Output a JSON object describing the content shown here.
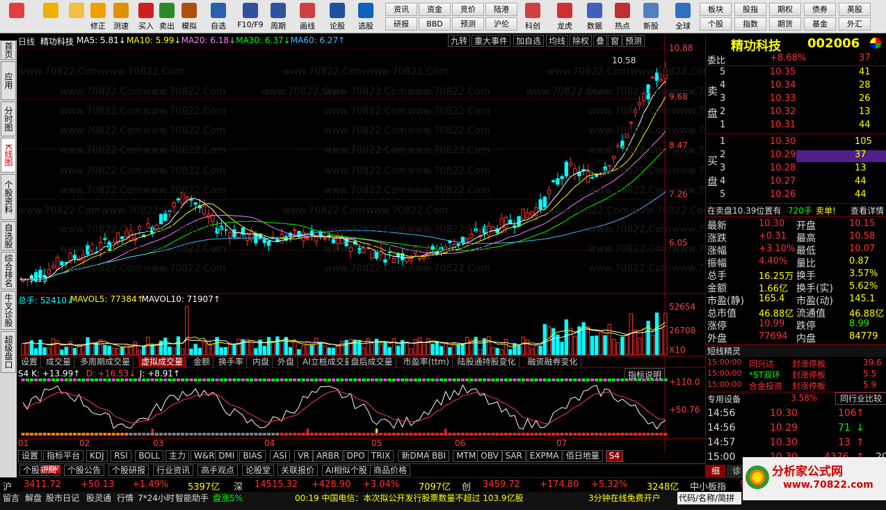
{
  "toolbar": {
    "big": [
      {
        "name": "refresh-icon",
        "label": ""
      },
      {
        "name": "back-icon",
        "label": ""
      },
      {
        "name": "up-icon",
        "label": ""
      },
      {
        "name": "repair-icon",
        "label": "修正"
      },
      {
        "name": "test-speed-icon",
        "label": "测速"
      },
      {
        "name": "buy-icon",
        "label": "买入"
      },
      {
        "name": "sell-icon",
        "label": "卖出"
      },
      {
        "name": "simulate-icon",
        "label": "模拟"
      },
      {
        "name": "self-select-icon",
        "label": "自选"
      },
      {
        "name": "f10-icon",
        "label": "F10/F9"
      },
      {
        "name": "period-icon",
        "label": "周期"
      },
      {
        "name": "draw-line-icon",
        "label": "画线"
      },
      {
        "name": "stock-talk-icon",
        "label": "论股"
      },
      {
        "name": "pick-stock-icon",
        "label": "选股"
      },
      {
        "name": "kechuang-icon",
        "label": "科创"
      },
      {
        "name": "dragon-tiger-icon",
        "label": "龙虎"
      },
      {
        "name": "data-icon",
        "label": "数据"
      },
      {
        "name": "hot-icon",
        "label": "热点"
      },
      {
        "name": "new-stock-icon",
        "label": "新股"
      },
      {
        "name": "global-icon",
        "label": "全球"
      }
    ],
    "small": [
      "资讯",
      "资金",
      "竞价",
      "陆港",
      "研报",
      "BBD",
      "预测",
      "沪伦",
      "板块",
      "股指",
      "期权",
      "债券",
      "英股",
      "个股",
      "指数",
      "期货",
      "基金",
      "外汇"
    ]
  },
  "vtabs": [
    "首页",
    "应用",
    "分时图",
    "K线图",
    "个股资料",
    "自选股",
    "综合排名",
    "牛叉诊股",
    "超级盘口"
  ],
  "chart": {
    "period": "日线",
    "stock_name": "精功科技",
    "ma": [
      {
        "label": "MA5: 5.81↓",
        "color": "#ffffff"
      },
      {
        "label": "MA10: 5.99↓",
        "color": "#ffff00"
      },
      {
        "label": "MA20: 6.18↓",
        "color": "#ff80ff"
      },
      {
        "label": "MA30: 6.37↓",
        "color": "#00ff00"
      },
      {
        "label": "MA60: 6.27↑",
        "color": "#40c0ff"
      }
    ],
    "top_buttons": [
      "九转",
      "重大事件",
      "加自选",
      "均线",
      "除权",
      "叠",
      "窗",
      "预测"
    ],
    "price_axis": [
      "10.88",
      "9.68",
      "8.47",
      "7.26",
      "6.05"
    ],
    "high_label": "10.58",
    "low_label": "5.13",
    "watermarks": [
      "分析家公式网www.70822.Com",
      "www.70822.Com",
      "分析家公式网 www.70822.Com"
    ],
    "volume": {
      "header": [
        {
          "label": "总手: 52410↓",
          "color": "#00ffff"
        },
        {
          "label": "MAVOL5: 77384↑",
          "color": "#ffff00"
        },
        {
          "label": "MAVOL10: 71907↑",
          "color": "#ffffff"
        }
      ],
      "axis": [
        "52654",
        "26708"
      ],
      "unit": "X10"
    },
    "vol_tabs": [
      "设置",
      "成交量",
      "多周期成交量",
      "虚拟成交量",
      "金额",
      "换手率",
      "内盘",
      "外盘",
      "AI立桩成交量",
      "盘后成交量",
      "市盈率(ttm)",
      "陆股通持股变化",
      "融资融券变化"
    ],
    "kdj": {
      "header": [
        {
          "label": "S4 K: +13.99↑",
          "color": "#ffffff"
        },
        {
          "label": "D: +16.53↓",
          "color": "#ff4040"
        },
        {
          "label": "J: +8.91↑",
          "color": "#ffffff"
        }
      ],
      "help": "指标说明",
      "axis": [
        "+110.0",
        "+50.76"
      ]
    },
    "months": [
      "01",
      "02",
      "03",
      "04",
      "05",
      "06",
      "07"
    ],
    "ind_tabs": [
      "设置",
      "指标平台",
      "KDJ",
      "RSI",
      "BOLL",
      "主力",
      "W&R",
      "DMI",
      "BIAS",
      "ASI",
      "VR",
      "ARBR",
      "DPO",
      "TRIX",
      "新DMA",
      "BBI",
      "MTM",
      "OBV",
      "SAR",
      "EXPMA",
      "佰日地量",
      "S4"
    ],
    "news_tabs": [
      "个股新闻",
      "个股公告",
      "个股研报",
      "行业资讯",
      "高手观点",
      "论股堂",
      "关联报价",
      "AI相似个股",
      "商品价格"
    ],
    "new_badge": "NEW"
  },
  "right": {
    "title": "精功科技",
    "code": "002006",
    "weibi": {
      "label": "委比",
      "value": "+8.68%",
      "extra": "37"
    },
    "sell_label": [
      "卖",
      "盘"
    ],
    "buy_label": [
      "买",
      "盘"
    ],
    "asks": [
      {
        "lvl": "5",
        "price": "10.35",
        "vol": "41"
      },
      {
        "lvl": "4",
        "price": "10.34",
        "vol": "28"
      },
      {
        "lvl": "3",
        "price": "10.33",
        "vol": "26"
      },
      {
        "lvl": "2",
        "price": "10.32",
        "vol": "13"
      },
      {
        "lvl": "1",
        "price": "10.31",
        "vol": "44"
      }
    ],
    "bids": [
      {
        "lvl": "1",
        "price": "10.30",
        "vol": "105"
      },
      {
        "lvl": "2",
        "price": "10.29",
        "vol": "37"
      },
      {
        "lvl": "3",
        "price": "10.28",
        "vol": "13"
      },
      {
        "lvl": "4",
        "price": "10.27",
        "vol": "44"
      },
      {
        "lvl": "5",
        "price": "10.26",
        "vol": "44"
      }
    ],
    "order_note": {
      "text": "在卖盘10.39位置有",
      "vol": "720手",
      "act": "卖单!",
      "link": "查看详情"
    },
    "quote": [
      {
        "l": "最新",
        "v": "10.30",
        "l2": "开盘",
        "v2": "10.15"
      },
      {
        "l": "涨跌",
        "v": "+0.31",
        "l2": "最高",
        "v2": "10.58"
      },
      {
        "l": "涨幅",
        "v": "+3.10%",
        "l2": "最低",
        "v2": "10.07"
      },
      {
        "l": "振幅",
        "v": "4.40%",
        "l2": "量比",
        "v2": "0.87"
      },
      {
        "l": "总手",
        "v": "16.25万",
        "l2": "换手",
        "v2": "3.57%"
      },
      {
        "l": "金额",
        "v": "1.66亿",
        "l2": "换手(实)",
        "v2": "5.62%"
      },
      {
        "l": "市盈(静)",
        "v": "165.4",
        "l2": "市盈(动)",
        "v2": "145.1"
      },
      {
        "l": "总市值",
        "v": "46.88亿",
        "l2": "流通值",
        "v2": "46.88亿"
      },
      {
        "l": "涨停",
        "v": "10.99",
        "l2": "跌停",
        "v2": "8.99"
      },
      {
        "l": "外盘",
        "v": "77694",
        "l2": "内盘",
        "v2": "84779"
      }
    ],
    "sprite_title": "短线精灵",
    "sprite": [
      {
        "t": "15:00:00",
        "n": "同兴达",
        "e": "封涨停板",
        "v": "39.6"
      },
      {
        "t": "15:00:00",
        "n": "*ST双环",
        "e": "封涨停板",
        "v": "5.5"
      },
      {
        "t": "15:00:00",
        "n": "合金投资",
        "e": "封涨停板",
        "v": "5.9"
      }
    ],
    "industry": {
      "name": "专用设备",
      "pct": "3.58%",
      "link": "同行业比较"
    },
    "ticks": [
      {
        "t": "14:56",
        "p": "10.30",
        "v": "106",
        "d": "↑"
      },
      {
        "t": "14:56",
        "p": "10.29",
        "v": "71",
        "d": "↓"
      },
      {
        "t": "14:57",
        "p": "10.30",
        "v": "13",
        "d": "↑"
      },
      {
        "t": "15:00",
        "p": "10.30",
        "v": "4376",
        "d": "↑",
        "x": "20"
      }
    ],
    "detail_tabs": [
      "细",
      "诊"
    ]
  },
  "status": {
    "sh": {
      "name": "沪",
      "idx": "3411.72",
      "chg": "+50.13",
      "pct": "+1.49%",
      "amt": "5397亿"
    },
    "sz": {
      "name": "深",
      "idx": "14515.32",
      "chg": "+428.90",
      "pct": "+3.04%",
      "amt": "7097亿"
    },
    "cy": {
      "name": "创",
      "idx": "3459.72",
      "chg": "+174.80",
      "pct": "+5.32%",
      "amt": "3248亿"
    },
    "zxb": "中小板指",
    "zxb_idx": "9",
    "bottom": [
      "留言",
      "解盘",
      "股市日记",
      "股灵通",
      "行情",
      "7*24小时",
      "智能助手"
    ],
    "pan": "盘涨5%",
    "news": "00:19 中国电信：本次拟公开发行股票数量不超过 103.9亿股",
    "ad": "3分钟在线免费开户",
    "search": "代码/名称/简拼",
    "logo": "分析家公式网",
    "logo_url": "www.70822.com"
  }
}
